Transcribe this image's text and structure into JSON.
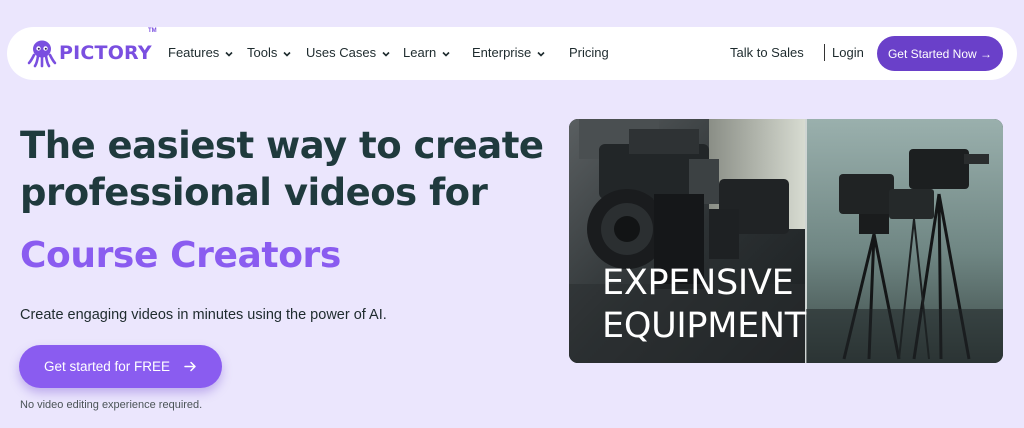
{
  "nav": {
    "logo_text": "PICTORY",
    "logo_tm": "TM",
    "items": [
      {
        "label": "Features",
        "dropdown": true
      },
      {
        "label": "Tools",
        "dropdown": true
      },
      {
        "label": "Uses Cases",
        "dropdown": true
      },
      {
        "label": "Learn",
        "dropdown": true
      },
      {
        "label": "Enterprise",
        "dropdown": true
      },
      {
        "label": "Pricing",
        "dropdown": false
      }
    ],
    "talk_to_sales": "Talk to Sales",
    "login": "Login",
    "cta_label": "Get Started Now →"
  },
  "hero": {
    "title_line1": "The easiest way to create",
    "title_line2": "professional videos for",
    "accent": "Course Creators",
    "subtitle": "Create engaging videos in minutes using the power of AI.",
    "cta_label": "Get started for FREE",
    "cta_icon": "arrow-right-icon",
    "note": "No video editing experience required."
  },
  "media": {
    "caption_line1": "EXPENSIVE",
    "caption_line2": "EQUIPMENT"
  },
  "colors": {
    "page_bg": "#ebe6fd",
    "brand_purple": "#6a40c9",
    "accent_purple": "#8a5cf0",
    "heading": "#1f3a3d"
  }
}
